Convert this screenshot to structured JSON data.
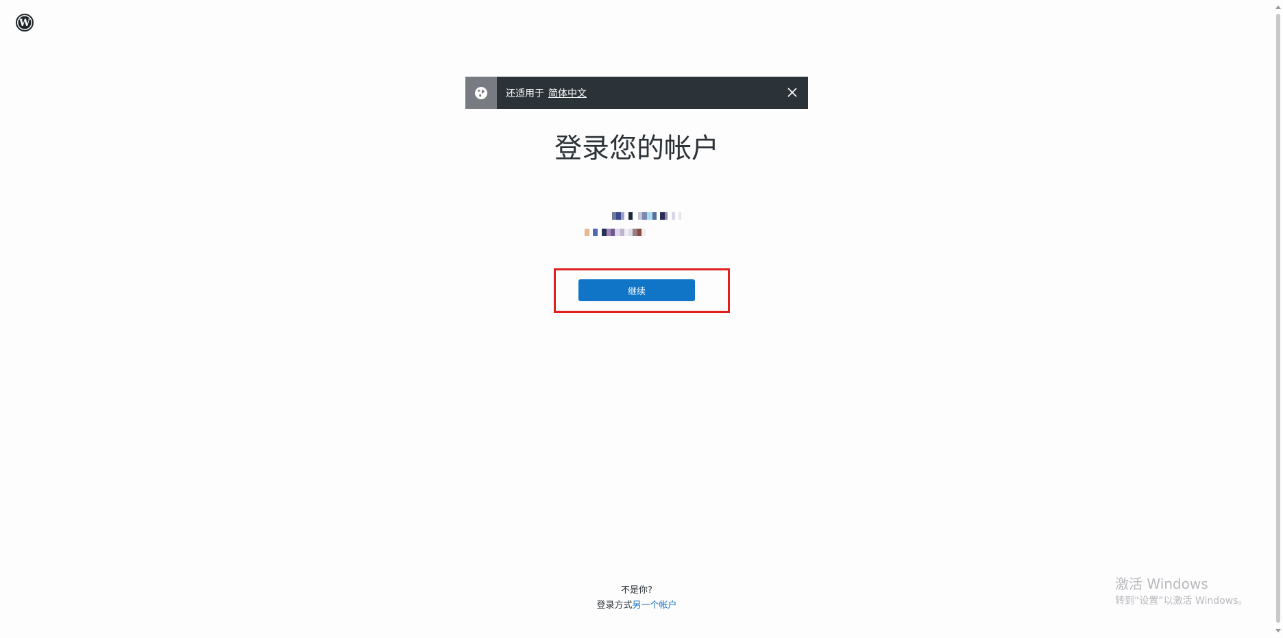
{
  "brand": {
    "logo_icon": "wordpress-icon"
  },
  "notice": {
    "icon": "globe-icon",
    "prefix": "还适用于",
    "language_link": "简体中文",
    "close_icon": "close-icon"
  },
  "title": "登录您的帐户",
  "account": {
    "obscured": true
  },
  "continue_button": {
    "label": "继续"
  },
  "footer": {
    "question": "不是你?",
    "switch_prefix": "登录方式",
    "switch_link": "另一个帐户"
  },
  "watermark": {
    "title": "激活 Windows",
    "subtitle": "转到“设置”以激活 Windows。"
  },
  "colors": {
    "primary_button": "#1175c7",
    "notice_bg": "#2c3338",
    "notice_icon_bg": "#787c82",
    "highlight_border": "#e01e1e",
    "link": "#1170c4"
  }
}
